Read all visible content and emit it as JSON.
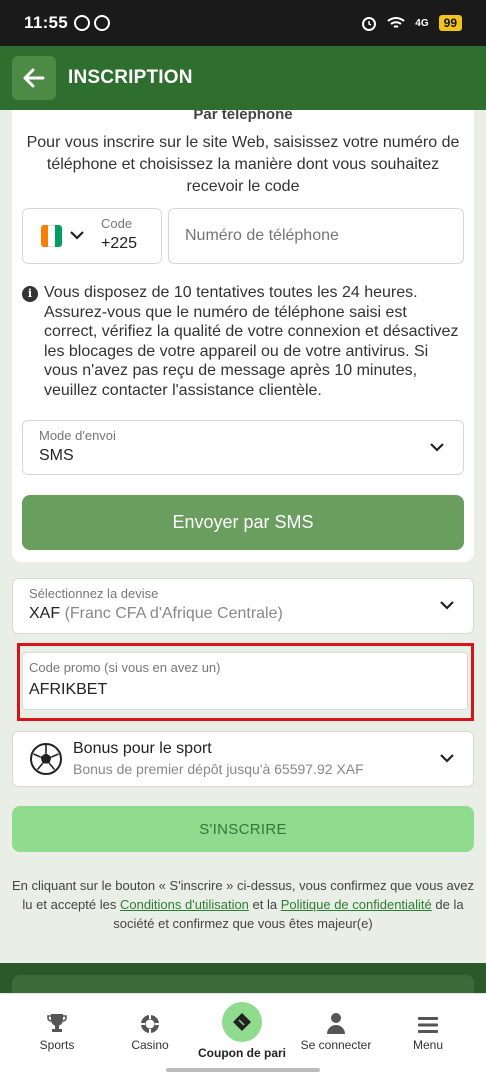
{
  "status_bar": {
    "time": "11:55",
    "battery": "99",
    "network": "4G"
  },
  "header": {
    "title": "INSCRIPTION"
  },
  "phone_section": {
    "heading": "Par téléphone",
    "intro": "Pour vous inscrire sur le site Web, saisissez votre numéro de téléphone et choisissez la manière dont vous souhaitez recevoir le code",
    "code_label": "Code",
    "code_value": "+225",
    "phone_placeholder": "Numéro de téléphone",
    "info": "Vous disposez de 10 tentatives toutes les 24 heures. Assurez-vous que le numéro de téléphone saisi est correct, vérifiez la qualité de votre connexion et désactivez les blocages de votre appareil ou de votre antivirus. Si vous n'avez pas reçu de message après 10 minutes, veuillez contacter l'assistance clientèle.",
    "mode_label": "Mode d'envoi",
    "mode_value": "SMS",
    "send_button": "Envoyer par SMS"
  },
  "currency": {
    "label": "Sélectionnez la devise",
    "code": "XAF",
    "name": "(Franc CFA d'Afrique Centrale)"
  },
  "promo": {
    "label": "Code promo (si vous en avez un)",
    "value": "AFRIKBET"
  },
  "bonus": {
    "title": "Bonus pour le sport",
    "subtitle": "Bonus de premier dépôt jusqu'à 65597.92 XAF"
  },
  "register_button": "S'INSCRIRE",
  "legal": {
    "part1": "En cliquant sur le bouton « S'inscrire » ci-dessus, vous confirmez que vous avez lu et accepté les ",
    "link1": "Conditions d'utilisation",
    "part2": " et la ",
    "link2": "Politique de confidentialité",
    "part3": " de la société et confirmez que vous êtes majeur(e)"
  },
  "nav": {
    "sports": "Sports",
    "casino": "Casino",
    "coupon": "Coupon de pari",
    "login": "Se connecter",
    "menu": "Menu"
  },
  "colors": {
    "header_green": "#2e6e2e",
    "send_button": "#6a9e5e",
    "register_button": "#8fdc8f",
    "highlight_red": "#d8141b",
    "flag_orange": "#f77f00",
    "flag_white": "#ffffff",
    "flag_green": "#009e60"
  }
}
